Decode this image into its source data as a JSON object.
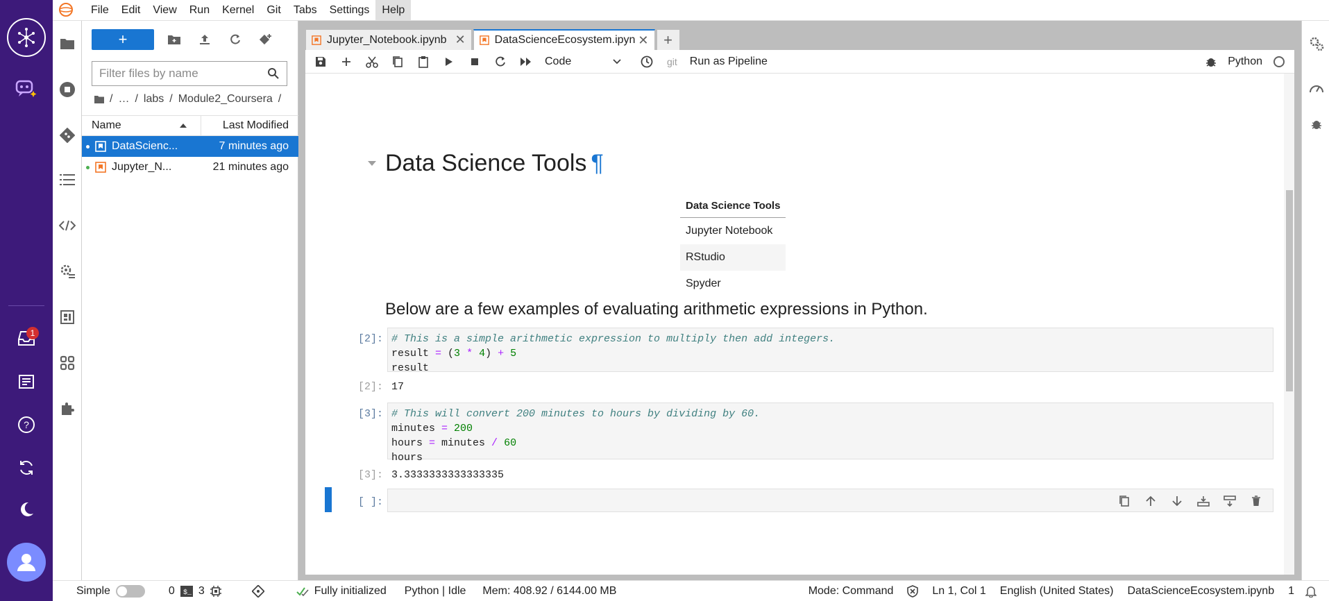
{
  "menu": [
    "File",
    "Edit",
    "View",
    "Run",
    "Kernel",
    "Git",
    "Tabs",
    "Settings",
    "Help"
  ],
  "rail": {
    "inbox_badge": "1"
  },
  "filebrowser": {
    "filter_placeholder": "Filter files by name",
    "breadcrumb": [
      "…",
      "labs",
      "Module2_Coursera"
    ],
    "col_name": "Name",
    "col_modified": "Last Modified",
    "files": [
      {
        "name": "DataScienc...",
        "modified": "7 minutes ago"
      },
      {
        "name": "Jupyter_N...",
        "modified": "21 minutes ago"
      }
    ]
  },
  "tabs": [
    {
      "label": "Jupyter_Notebook.ipynb"
    },
    {
      "label": "DataScienceEcosystem.ipyn"
    }
  ],
  "toolbar": {
    "cell_type": "Code",
    "git": "git",
    "run_pipeline": "Run as Pipeline",
    "kernel": "Python"
  },
  "notebook": {
    "heading": "Data Science Tools",
    "pilcrow": "¶",
    "table_header": "Data Science Tools",
    "table_rows": [
      "Jupyter Notebook",
      "RStudio",
      "Spyder"
    ],
    "subheading": "Below are a few examples of evaluating arithmetic expressions in Python.",
    "cell1": {
      "prompt_in": "[2]:",
      "comment": "# This is a simple arithmetic expression to multiply then add integers.",
      "line2_a": "result ",
      "line2_eq": "=",
      "line2_b": " (",
      "line2_n1": "3",
      "line2_c": " ",
      "line2_mul": "*",
      "line2_d": " ",
      "line2_n2": "4",
      "line2_e": ") ",
      "line2_plus": "+",
      "line2_f": " ",
      "line2_n3": "5",
      "line3": "result",
      "prompt_out": "[2]:",
      "output": "17"
    },
    "cell2": {
      "prompt_in": "[3]:",
      "comment": "# This will convert 200 minutes to hours by dividing by 60.",
      "l2_a": "minutes ",
      "l2_eq": "=",
      "l2_sp": " ",
      "l2_n": "200",
      "l3_a": "hours ",
      "l3_eq": "=",
      "l3_b": " minutes ",
      "l3_div": "/",
      "l3_sp": " ",
      "l3_n": "60",
      "l4": "hours",
      "prompt_out": "[3]:",
      "output": "3.3333333333333335"
    },
    "empty_prompt": "[ ]:"
  },
  "status": {
    "simple": "Simple",
    "terminals": "0",
    "kernels": "3",
    "init": "Fully initialized",
    "kernel_state": "Python | Idle",
    "mem": "Mem: 408.92 / 6144.00 MB",
    "mode": "Mode: Command",
    "position": "Ln 1, Col 1",
    "language": "English (United States)",
    "filename": "DataScienceEcosystem.ipynb",
    "count": "1"
  }
}
